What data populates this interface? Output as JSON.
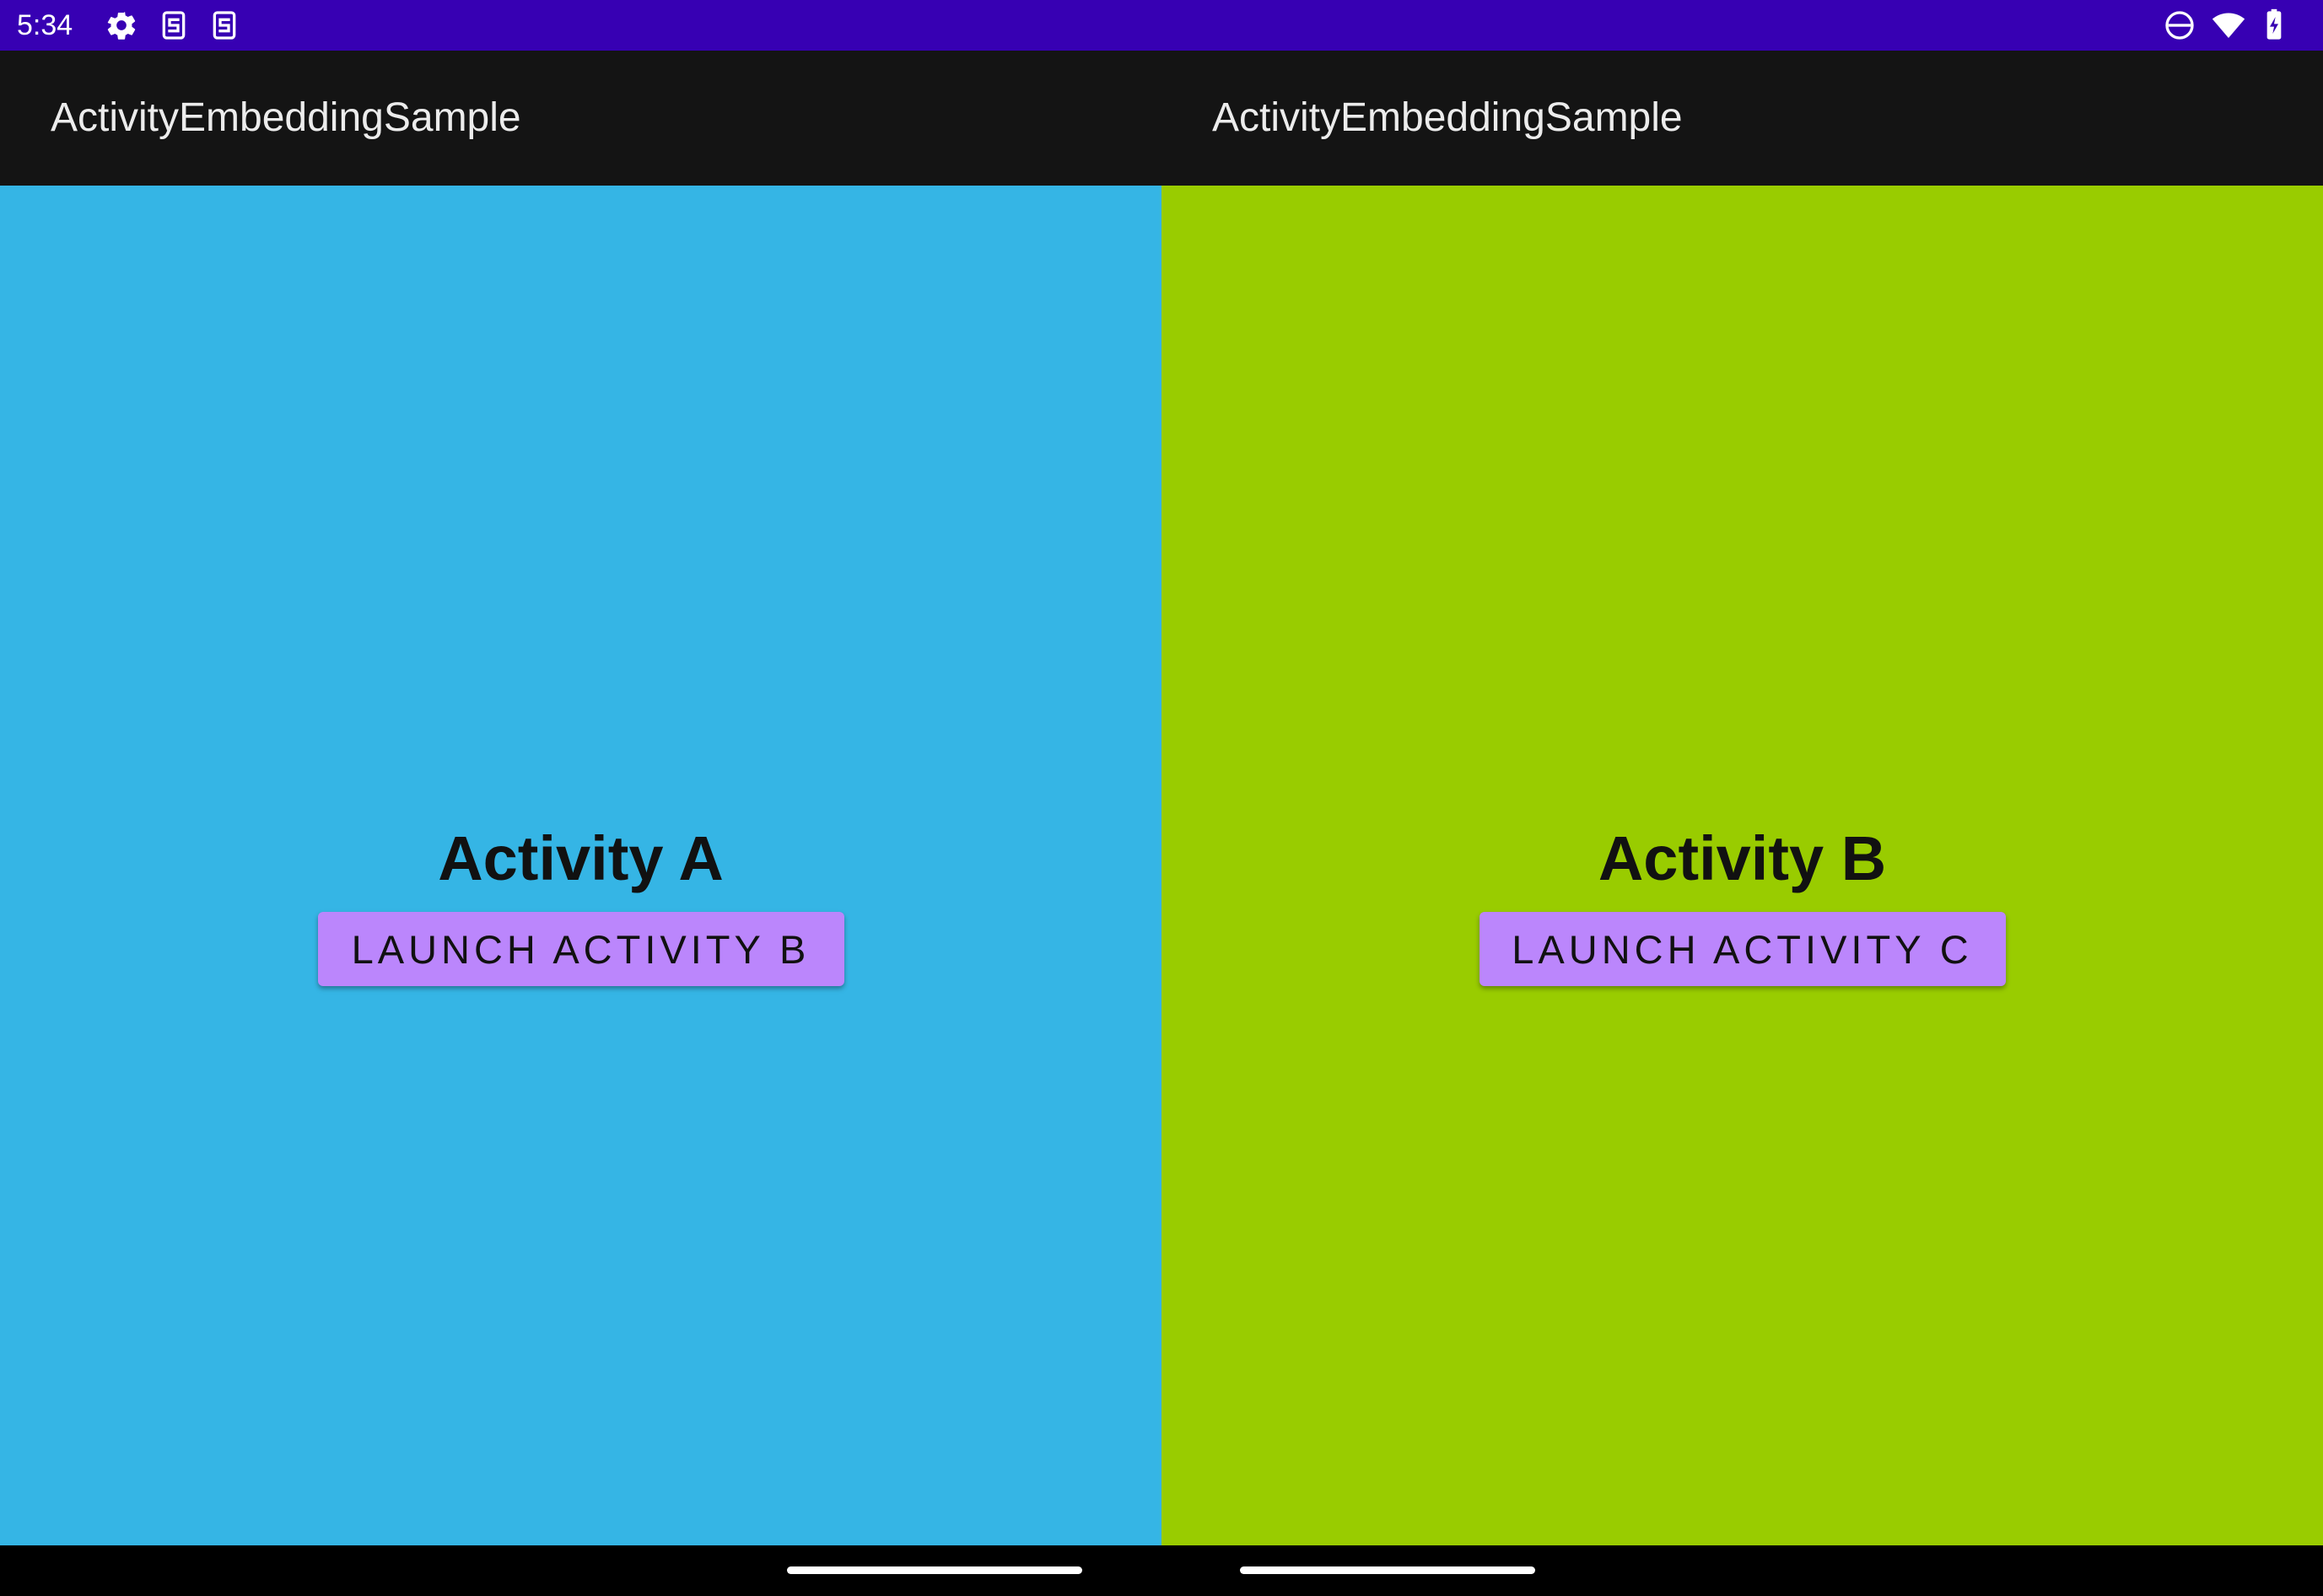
{
  "status_bar": {
    "time": "5:34",
    "background": "#3700B3",
    "left_icons": [
      "settings-gear-icon",
      "sim-card-icon",
      "sim-card-icon"
    ],
    "right_icons": [
      "do-not-disturb-icon",
      "wifi-icon",
      "battery-charging-icon"
    ]
  },
  "left_pane": {
    "app_title": "ActivityEmbeddingSample",
    "heading": "Activity A",
    "button_label": "LAUNCH ACTIVITY B",
    "background": "#35B5E5",
    "button_color": "#BB86FC"
  },
  "right_pane": {
    "app_title": "ActivityEmbeddingSample",
    "heading": "Activity B",
    "button_label": "LAUNCH ACTIVITY C",
    "background": "#99CC00",
    "button_color": "#BB86FC"
  },
  "nav_bar": {
    "handles": [
      "gesture-handle-left",
      "gesture-handle-right"
    ]
  }
}
